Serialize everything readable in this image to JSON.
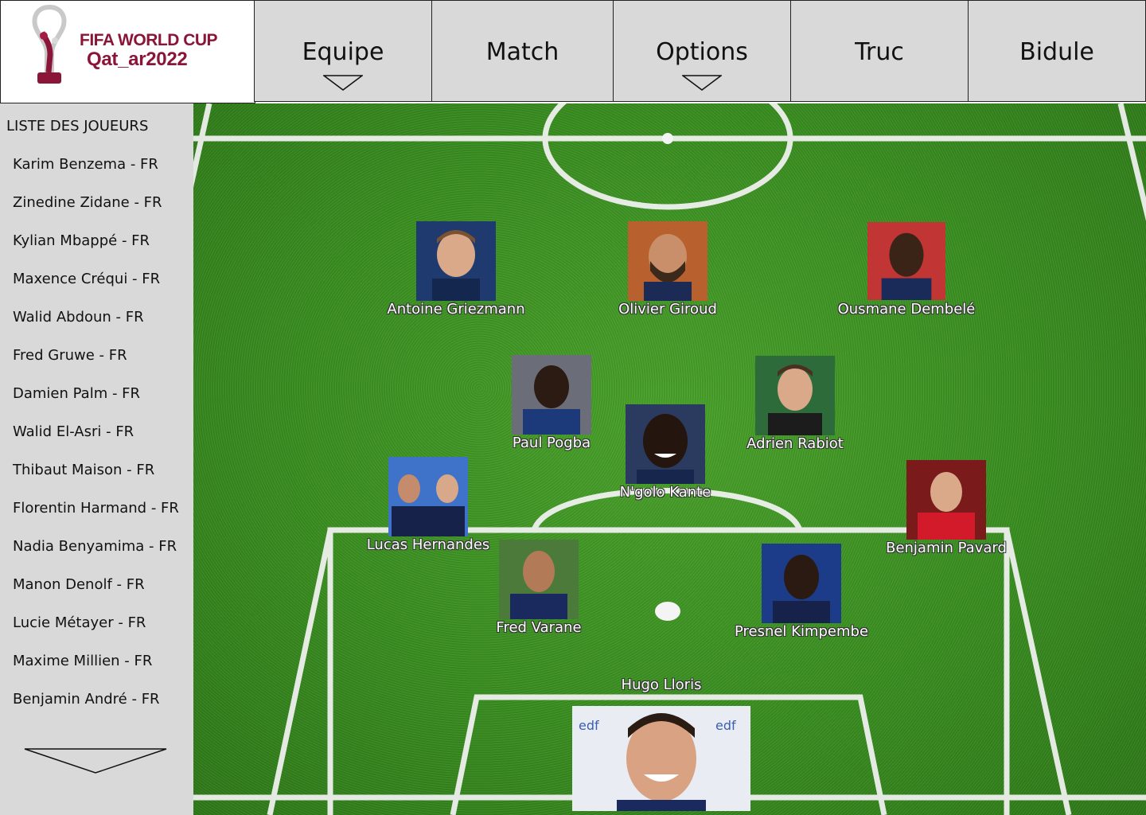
{
  "logo": {
    "line1": "FIFA WORLD CUP",
    "line2": "Qat_ar2022"
  },
  "nav": [
    {
      "label": "Equipe",
      "has_dropdown": true
    },
    {
      "label": "Match",
      "has_dropdown": false
    },
    {
      "label": "Options",
      "has_dropdown": true
    },
    {
      "label": "Truc",
      "has_dropdown": false
    },
    {
      "label": "Bidule",
      "has_dropdown": false
    }
  ],
  "sidebar": {
    "title": "LISTE DES JOUEURS",
    "players": [
      "Karim Benzema - FR",
      "Zinedine Zidane - FR",
      "Kylian Mbappé - FR",
      "Maxence Créqui - FR",
      "Walid Abdoun - FR",
      "Fred Gruwe - FR",
      "Damien Palm - FR",
      "Walid El-Asri - FR",
      "Thibaut Maison - FR",
      "Florentin Harmand - FR",
      "Nadia Benyamima - FR",
      "Manon Denolf - FR",
      "Lucie Métayer - FR",
      "Maxime Millien - FR",
      "Benjamin André - FR"
    ]
  },
  "lineup": {
    "griezmann": "Antoine Griezmann",
    "giroud": "Olivier Giroud",
    "dembele": "Ousmane Dembelé",
    "pogba": "Paul Pogba",
    "kante": "N'golo Kante",
    "rabiot": "Adrien Rabiot",
    "hernandes": "Lucas Hernandes",
    "pavard": "Benjamin Pavard",
    "varane": "Fred Varane",
    "kimpembe": "Presnel Kimpembe",
    "lloris": "Hugo Lloris"
  },
  "colors": {
    "nav_bg": "#d9d9d9",
    "brand": "#8a1538",
    "grass": "#3a8f21",
    "lines": "#ffffff"
  }
}
